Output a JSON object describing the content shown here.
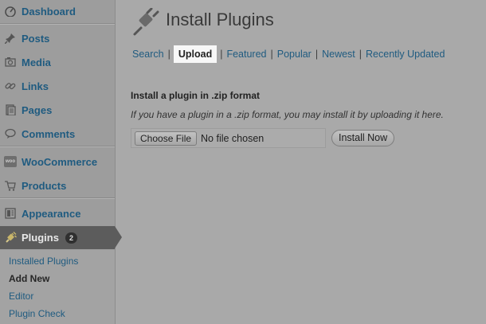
{
  "sidebar": {
    "items": [
      {
        "label": "Dashboard",
        "icon": "dashboard-icon"
      },
      {
        "label": "Posts",
        "icon": "pushpin-icon"
      },
      {
        "label": "Media",
        "icon": "media-icon"
      },
      {
        "label": "Links",
        "icon": "link-icon"
      },
      {
        "label": "Pages",
        "icon": "pages-icon"
      },
      {
        "label": "Comments",
        "icon": "comment-icon"
      },
      {
        "label": "WooCommerce",
        "icon": "woocommerce-icon",
        "icon_text": "woo"
      },
      {
        "label": "Products",
        "icon": "cart-icon"
      },
      {
        "label": "Appearance",
        "icon": "appearance-icon"
      },
      {
        "label": "Plugins",
        "icon": "plug-icon",
        "badge": "2"
      }
    ],
    "submenu": [
      "Installed Plugins",
      "Add New",
      "Editor",
      "Plugin Check"
    ],
    "submenu_current": "Add New"
  },
  "main": {
    "title": "Install Plugins",
    "tabs": [
      "Search",
      "Upload",
      "Featured",
      "Popular",
      "Newest",
      "Recently Updated"
    ],
    "tab_separator": "|",
    "current_tab": "Upload",
    "upload": {
      "heading": "Install a plugin in .zip format",
      "description": "If you have a plugin in a .zip format, you may install it by uploading it here.",
      "choose_file_label": "Choose File",
      "file_status": "No file chosen",
      "install_button": "Install Now"
    }
  },
  "colors": {
    "link": "#1f5b80",
    "sidebar_bg": "#9d9d9d",
    "page_bg": "#a9a9a9",
    "current_menu_bg": "#5c5c5c"
  }
}
